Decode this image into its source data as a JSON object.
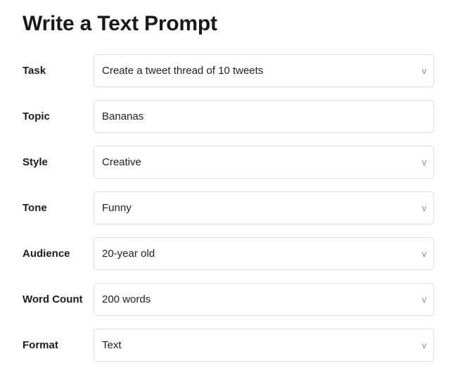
{
  "page": {
    "title": "Write a Text Prompt",
    "background_color": "#ffffff",
    "title_color": "#18191a",
    "field_border_color": "#dcdddf",
    "chevron_color": "#8b8d90"
  },
  "form": {
    "rows": [
      {
        "label": "Task",
        "value": "Create a tweet thread of 10 tweets",
        "control": "dropdown",
        "icon": "chevron-down-icon",
        "chevron": "v"
      },
      {
        "label": "Topic",
        "value": "Bananas",
        "control": "text-input",
        "icon": "",
        "chevron": ""
      },
      {
        "label": "Style",
        "value": "Creative",
        "control": "dropdown",
        "icon": "chevron-down-icon",
        "chevron": "v"
      },
      {
        "label": "Tone",
        "value": "Funny",
        "control": "dropdown",
        "icon": "chevron-down-icon",
        "chevron": "v"
      },
      {
        "label": "Audience",
        "value": "20-year old",
        "control": "dropdown",
        "icon": "chevron-down-icon",
        "chevron": "v"
      },
      {
        "label": "Word Count",
        "value": "200 words",
        "control": "dropdown",
        "icon": "chevron-down-icon",
        "chevron": "v"
      },
      {
        "label": "Format",
        "value": "Text",
        "control": "dropdown",
        "icon": "chevron-down-icon",
        "chevron": "v"
      }
    ]
  }
}
